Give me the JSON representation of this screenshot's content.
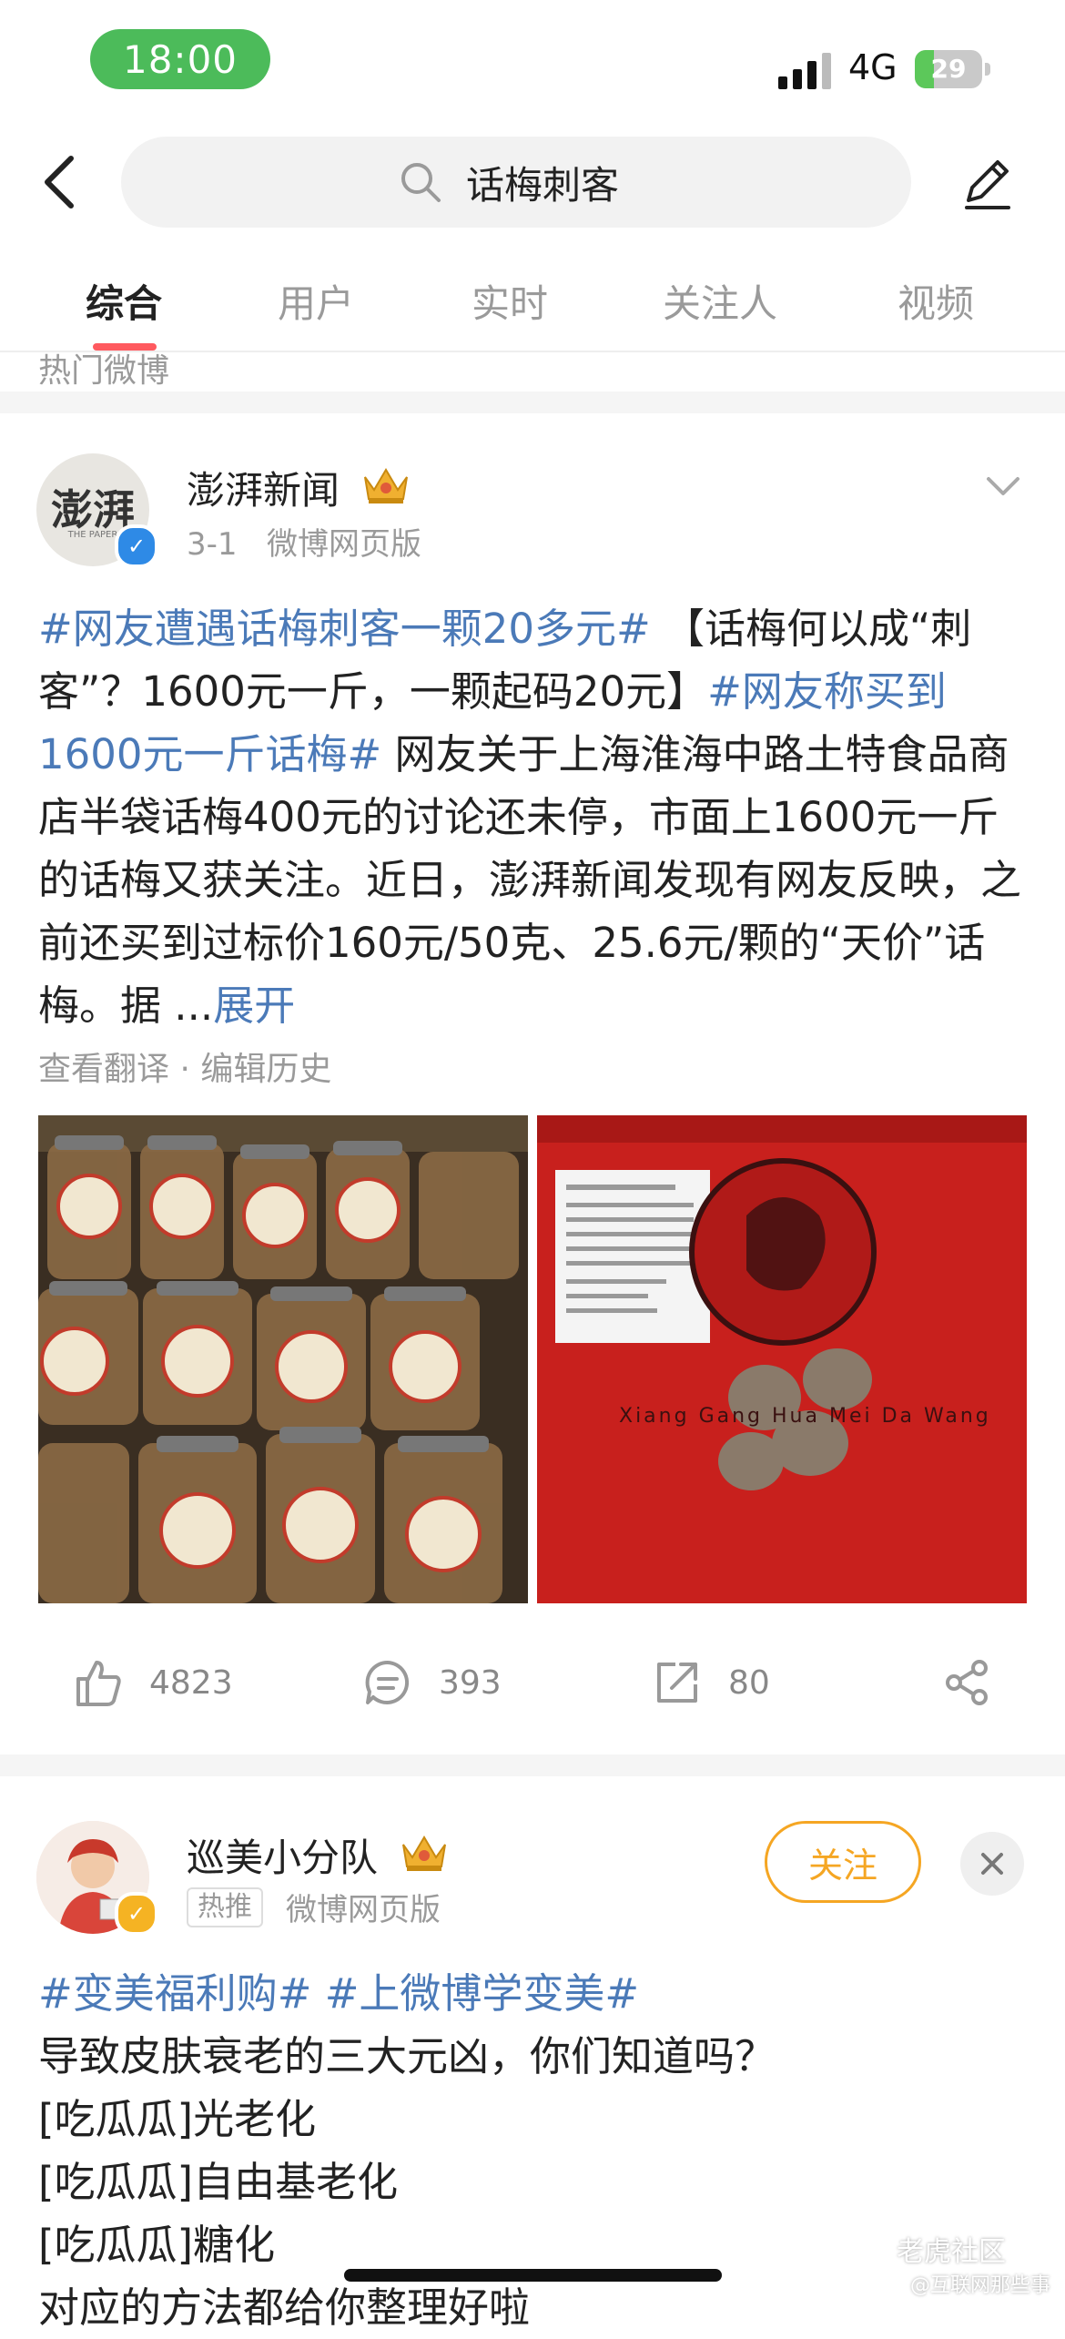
{
  "status_bar": {
    "time": "18:00",
    "network": "4G",
    "battery": "29",
    "battery_level": 0.29
  },
  "search": {
    "query": "话梅刺客"
  },
  "tabs": [
    {
      "label": "综合"
    },
    {
      "label": "用户"
    },
    {
      "label": "实时"
    },
    {
      "label": "关注人"
    },
    {
      "label": "视频"
    }
  ],
  "section_label": "热门微博",
  "post1": {
    "author": "澎湃新闻",
    "avatar_text": "澎湃",
    "avatar_sub": "THE PAPER",
    "meta": "3-1   微博网页版",
    "tag1": "#网友遭遇话梅刺客一颗20多元#",
    "text1": " 【话梅何以成“刺客”？1600元一斤，一颗起码20元】",
    "tag2": "#网友称买到1600元一斤话梅#",
    "text2": " 网友关于上海淮海中路土特食品商店半袋话梅400元的讨论还未停，市面上1600元一斤的话梅又获关注。近日，澎湃新闻发现有网友反映，之前还买到过标价160元/50克、25.6元/颗的“天价”话梅。据 ...",
    "expand": "展开",
    "sub_actions": "查看翻译 · 编辑历史",
    "photo2_text": "Xiang Gang Hua Mei Da Wang",
    "likes": "4823",
    "comments": "393",
    "reposts": "80"
  },
  "post2": {
    "author": "巡美小分队",
    "hot_badge": "热推",
    "meta": "微博网页版",
    "follow": "关注",
    "tags": "#变美福利购# #上微博学变美#",
    "lines": [
      "导致皮肤衰老的三大元凶，你们知道吗？",
      "[吃瓜瓜]光老化",
      "[吃瓜瓜]自由基老化",
      "[吃瓜瓜]糖化",
      "对应的方法都给你整理好啦"
    ]
  },
  "watermark": {
    "line1": "老虎社区",
    "line2": "@互联网那些事"
  },
  "colors": {
    "accent": "#ff5a5f",
    "link": "#4b7ab8",
    "time_pill": "#4cbb5a",
    "follow": "#f5a623"
  }
}
